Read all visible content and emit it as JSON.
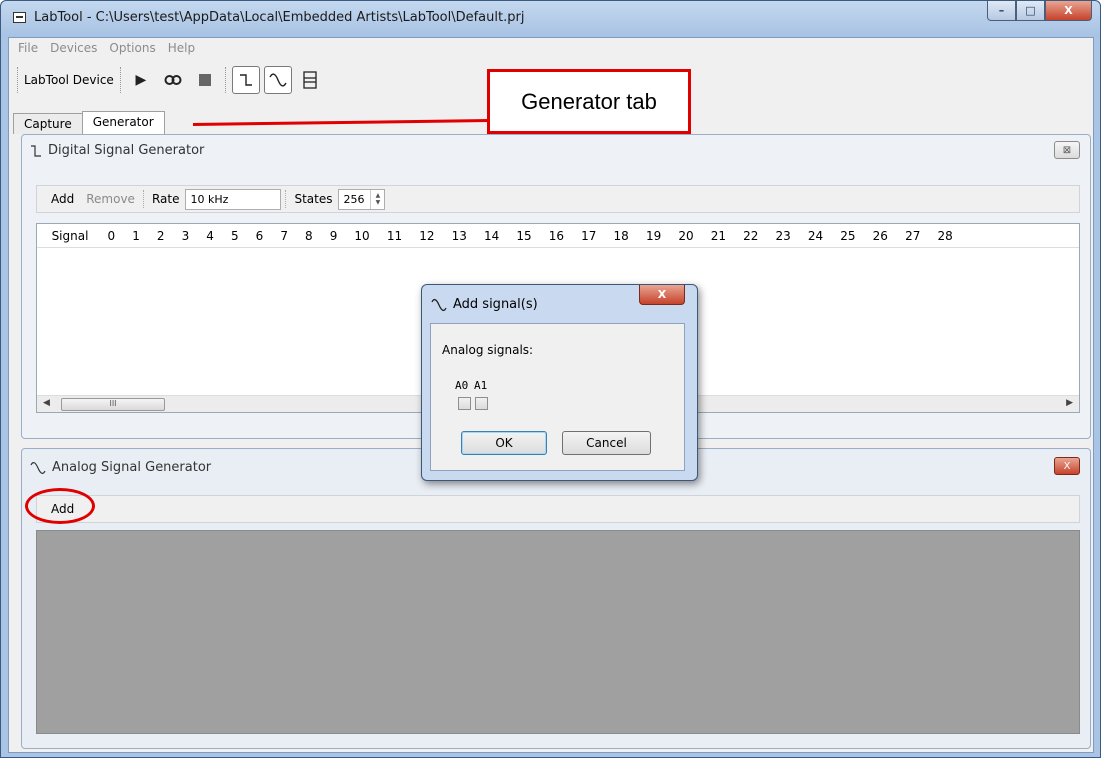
{
  "window": {
    "title": "LabTool - C:\\Users\\test\\AppData\\Local\\Embedded Artists\\LabTool\\Default.prj",
    "controls": {
      "minimize": "–",
      "maximize": "□",
      "close": "X"
    }
  },
  "menu": {
    "items": [
      "File",
      "Devices",
      "Options",
      "Help"
    ]
  },
  "toolbar": {
    "device_label": "LabTool Device",
    "run_icon": "▶",
    "continuous_icon": "∞",
    "stop_icon": "■",
    "digital_icon": "⎿",
    "analog_icon": "∿",
    "mixed_icon": "☰"
  },
  "tabs": [
    {
      "label": "Capture"
    },
    {
      "label": "Generator"
    }
  ],
  "digital_generator": {
    "title": "Digital Signal Generator",
    "close": "⊠",
    "add_label": "Add",
    "remove_label": "Remove",
    "rate_label": "Rate",
    "rate_value": "10 kHz",
    "states_label": "States",
    "states_value": "256",
    "columns": [
      "Signal",
      "0",
      "1",
      "2",
      "3",
      "4",
      "5",
      "6",
      "7",
      "8",
      "9",
      "10",
      "11",
      "12",
      "13",
      "14",
      "15",
      "16",
      "17",
      "18",
      "19",
      "20",
      "21",
      "22",
      "23",
      "24",
      "25",
      "26",
      "27",
      "28"
    ],
    "scroll_thumb": "III"
  },
  "analog_generator": {
    "title": "Analog Signal Generator",
    "close": "X",
    "add_label": "Add"
  },
  "dialog": {
    "title": "Add signal(s)",
    "close": "X",
    "section_label": "Analog signals:",
    "channels": [
      "A0",
      "A1"
    ],
    "ok_label": "OK",
    "cancel_label": "Cancel"
  },
  "annotation": {
    "callout_text": "Generator tab"
  },
  "colors": {
    "annotation_red": "#e00000",
    "window_frame": "#a9c4e4",
    "analog_area": "#a0a0a0"
  }
}
